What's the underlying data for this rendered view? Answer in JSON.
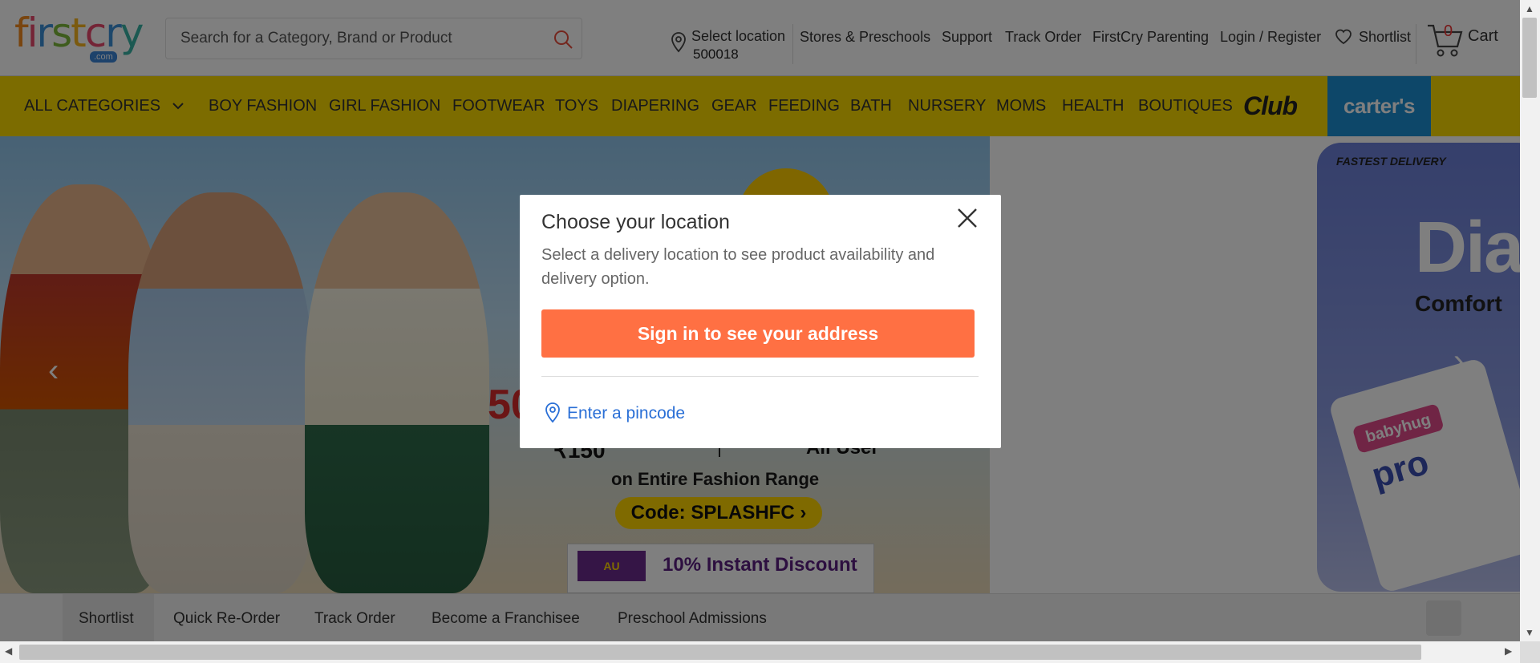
{
  "header": {
    "logo": {
      "letters": [
        "f",
        "i",
        "r",
        "s",
        "t",
        "c",
        "r",
        "y"
      ],
      "dotcom": ".com"
    },
    "search": {
      "placeholder": "Search for a Category, Brand or Product"
    },
    "location": {
      "label": "Select location",
      "pincode": "500018"
    },
    "links": {
      "stores": "Stores & Preschools",
      "support": "Support",
      "track": "Track Order",
      "parenting": "FirstCry Parenting",
      "login": "Login / Register",
      "shortlist": "Shortlist"
    },
    "cart": {
      "count": "0",
      "label": "Cart"
    }
  },
  "catnav": {
    "all": "ALL CATEGORIES",
    "items": [
      "BOY FASHION",
      "GIRL FASHION",
      "FOOTWEAR",
      "TOYS",
      "DIAPERING",
      "GEAR",
      "FEEDING",
      "BATH",
      "NURSERY",
      "MOMS",
      "HEALTH",
      "BOUTIQUES"
    ],
    "club": "Club",
    "carters": "carter's"
  },
  "hero": {
    "big": "50",
    "sub1": "₹150",
    "sub2": "All User",
    "range": "on Entire Fashion Range",
    "code": "Code: SPLASHFC ›",
    "bank_logo": "AU",
    "bank_offer": "10% Instant Discount"
  },
  "side_banner": {
    "fastest": "FASTEST DELIVERY",
    "title": "Dia",
    "comfort": "Comfort",
    "brand": "babyhug",
    "pro": "pro"
  },
  "footer": {
    "items": [
      "Shortlist",
      "Quick Re-Order",
      "Track Order",
      "Become a Franchisee",
      "Preschool Admissions"
    ]
  },
  "modal": {
    "title": "Choose your location",
    "description": "Select a delivery location to see product availability and delivery option.",
    "signin_button": "Sign in to see your address",
    "pincode_link": "Enter a pincode"
  },
  "colors": {
    "brand_yellow": "#f9d800",
    "signin_orange": "#ff7043",
    "link_blue": "#2a6fd6",
    "carters_blue": "#1a8fd3"
  },
  "icons": [
    "search-icon",
    "location-pin-icon",
    "heart-icon",
    "cart-icon",
    "chevron-down-icon",
    "close-icon",
    "arrow-left-icon",
    "arrow-right-icon"
  ]
}
